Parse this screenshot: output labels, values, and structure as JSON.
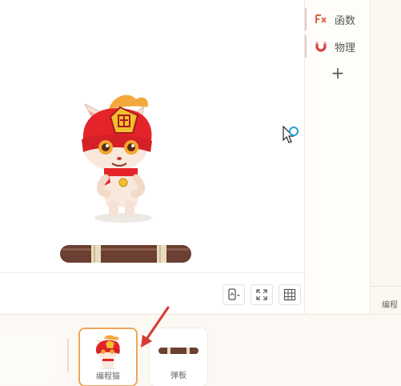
{
  "categories": [
    {
      "label": "函数",
      "icon": "function-icon",
      "color": "#e05d4c"
    },
    {
      "label": "物理",
      "icon": "magnet-icon",
      "color": "#d9433f"
    }
  ],
  "add_category_label": "+",
  "far_right_label": "编程",
  "stage_tools": [
    {
      "icon": "device-orientation-icon"
    },
    {
      "icon": "fullscreen-icon"
    },
    {
      "icon": "grid-icon"
    }
  ],
  "sprites": [
    {
      "name": "编程猫",
      "icon": "coding-cat-icon",
      "selected": true
    },
    {
      "name": "弹板",
      "icon": "springboard-icon",
      "selected": false
    }
  ],
  "colors": {
    "accent": "#f0a45a",
    "arrow": "#d83a32",
    "hero_red": "#e4242a",
    "board_brown": "#6b3f32"
  }
}
